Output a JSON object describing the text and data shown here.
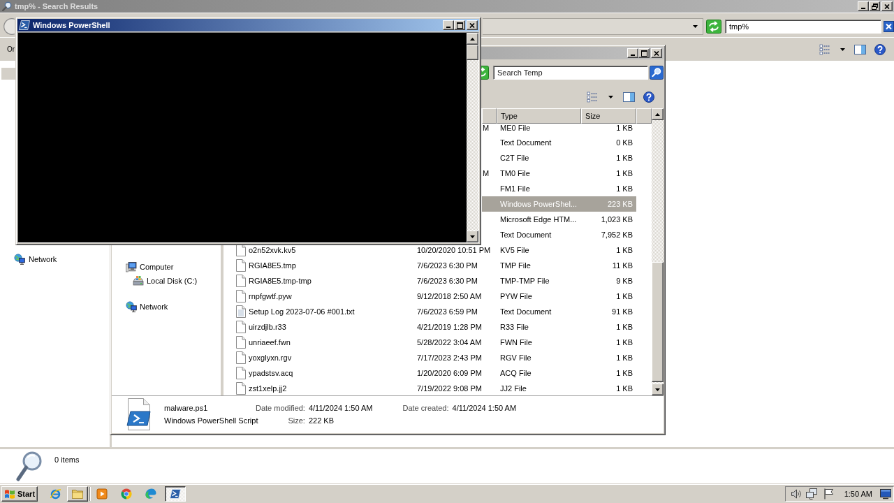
{
  "search_window": {
    "title": "tmp% - Search Results",
    "maximized": true,
    "search": {
      "value": "tmp%"
    },
    "toolbar": {
      "organize": "Or"
    },
    "nav": [
      {
        "selected": true
      },
      {
        "label": "Network",
        "selected": false
      }
    ],
    "status": {
      "count": "0 items"
    }
  },
  "temp_window": {
    "maximized": false,
    "search": {
      "placeholder": "Search Temp"
    },
    "nav": [
      {
        "label": "Computer",
        "kind": "computer",
        "children": [
          {
            "label": "Local Disk (C:)",
            "kind": "disk"
          }
        ]
      },
      {
        "label": "Network",
        "kind": "network"
      }
    ],
    "columns": [
      "Type",
      "Size"
    ],
    "files": [
      {
        "date": "M",
        "type": "ME0 File",
        "size": "1 KB",
        "selected": false
      },
      {
        "type": "Text Document",
        "size": "0 KB",
        "selected": false
      },
      {
        "type": "C2T File",
        "size": "1 KB",
        "selected": false
      },
      {
        "date": "M",
        "type": "TM0 File",
        "size": "1 KB",
        "selected": false
      },
      {
        "type": "FM1 File",
        "size": "1 KB",
        "selected": false
      },
      {
        "type": "Windows PowerShel...",
        "size": "223 KB",
        "selected": true
      },
      {
        "type": "Microsoft Edge HTM...",
        "size": "1,023 KB",
        "selected": false
      },
      {
        "type": "Text Document",
        "size": "7,952 KB",
        "selected": false
      },
      {
        "kind": "file",
        "name": "o2n52xvk.kv5",
        "date": "10/20/2020 10:51 PM",
        "type": "KV5 File",
        "size": "1 KB",
        "selected": false
      },
      {
        "kind": "file",
        "name": "RGIA8E5.tmp",
        "date": "7/6/2023 6:30 PM",
        "type": "TMP File",
        "size": "11 KB",
        "selected": false
      },
      {
        "kind": "file",
        "name": "RGIA8E5.tmp-tmp",
        "date": "7/6/2023 6:30 PM",
        "type": "TMP-TMP File",
        "size": "9 KB",
        "selected": false
      },
      {
        "kind": "file",
        "name": "rnpfgwtf.pyw",
        "date": "9/12/2018 2:50 AM",
        "type": "PYW File",
        "size": "1 KB",
        "selected": false
      },
      {
        "kind": "text",
        "name": "Setup Log 2023-07-06 #001.txt",
        "date": "7/6/2023 6:59 PM",
        "type": "Text Document",
        "size": "91 KB",
        "selected": false
      },
      {
        "kind": "file",
        "name": "uirzdjlb.r33",
        "date": "4/21/2019 1:28 PM",
        "type": "R33 File",
        "size": "1 KB",
        "selected": false
      },
      {
        "kind": "file",
        "name": "unriaeef.fwn",
        "date": "5/28/2022 3:04 AM",
        "type": "FWN File",
        "size": "1 KB",
        "selected": false
      },
      {
        "kind": "file",
        "name": "yoxglyxn.rgv",
        "date": "7/17/2023 2:43 PM",
        "type": "RGV File",
        "size": "1 KB",
        "selected": false
      },
      {
        "kind": "file",
        "name": "ypadstsv.acq",
        "date": "1/20/2020 6:09 PM",
        "type": "ACQ File",
        "size": "1 KB",
        "selected": false
      },
      {
        "kind": "file",
        "name": "zst1xelp.jj2",
        "date": "7/19/2022 9:08 PM",
        "type": "JJ2 File",
        "size": "1 KB",
        "selected": false
      }
    ],
    "details": {
      "name": "malware.ps1",
      "type": "Windows PowerShell Script",
      "fields": [
        {
          "label": "Date modified:",
          "value": "4/11/2024 1:50 AM"
        },
        {
          "label": "Size:",
          "value": "222 KB"
        },
        {
          "label": "Date created:",
          "value": "4/11/2024 1:50 AM"
        }
      ]
    }
  },
  "powershell_window": {
    "title": "Windows PowerShell",
    "maximized": false
  },
  "taskbar": {
    "start": "Start",
    "quick_launch": [
      {
        "kind": "ie",
        "running": false,
        "selected": false
      },
      {
        "kind": "explorer",
        "running": true,
        "selected": false
      }
    ],
    "apps": [
      {
        "kind": "media",
        "running": false,
        "selected": false
      },
      {
        "kind": "chrome",
        "running": false,
        "selected": false
      },
      {
        "kind": "edge",
        "running": false,
        "selected": false
      },
      {
        "kind": "powershell",
        "running": true,
        "selected": true
      }
    ],
    "clock": "1:50 AM"
  }
}
